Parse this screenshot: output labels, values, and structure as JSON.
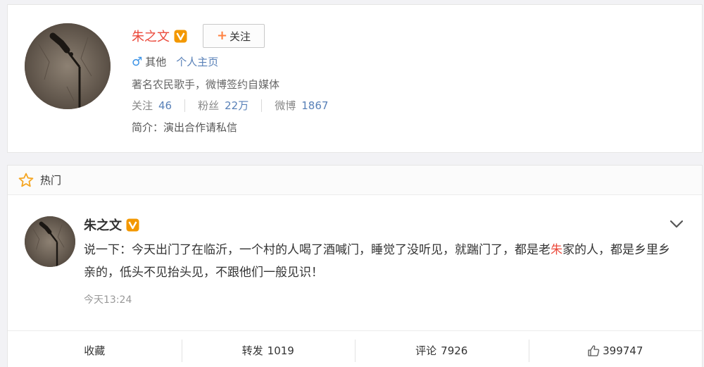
{
  "profile": {
    "name": "朱之文",
    "follow_button": "关注",
    "gender_text": "其他",
    "homepage_link": "个人主页",
    "description": "著名农民歌手，微博签约自媒体",
    "stats": [
      {
        "label": "关注",
        "value": "46"
      },
      {
        "label": "粉丝",
        "value": "22万"
      },
      {
        "label": "微博",
        "value": "1867"
      }
    ],
    "intro": "简介：演出合作请私信"
  },
  "hot_section": {
    "title": "热门"
  },
  "post": {
    "author": "朱之文",
    "text_part1": "说一下：今天出门了在临沂，一个村的人喝了酒喊门，睡觉了没听见，就踹门了，都是老",
    "text_highlight": "朱",
    "text_part2": "家的人，都是乡里乡亲的，低头不见抬头见，不跟他们一般见识！",
    "time": "今天13:24",
    "actions": {
      "favorite_label": "收藏",
      "repost_label": "转发",
      "repost_count": "1019",
      "comment_label": "评论",
      "comment_count": "7926",
      "like_count": "399747"
    }
  },
  "colors": {
    "brand_red": "#eb4a3c",
    "link_blue": "#5981b8",
    "male_blue": "#3b93e6",
    "verified_orange": "#f39800"
  },
  "icons": [
    "avatar-microphone",
    "verified-v-icon",
    "plus-icon",
    "male-icon",
    "star-icon",
    "chevron-down-icon",
    "thumbs-up-icon"
  ]
}
